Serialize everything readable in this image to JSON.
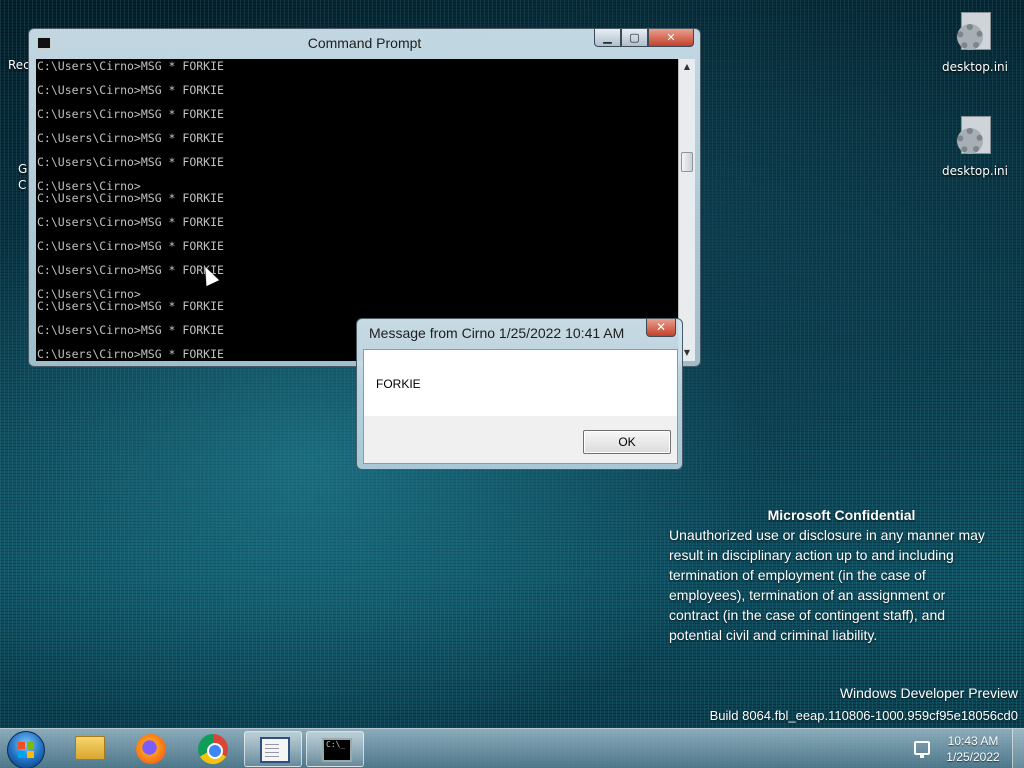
{
  "desktop": {
    "icons": [
      {
        "label": "desktop.ini"
      },
      {
        "label": "desktop.ini"
      }
    ],
    "edge_labels": {
      "top": "Rec",
      "mid1": "G",
      "mid2": "C"
    }
  },
  "cmd_window": {
    "title": "Command Prompt",
    "buttons": {
      "minimize": "▁",
      "maximize": "▢",
      "close": "✕"
    },
    "lines": [
      "C:\\Users\\Cirno>MSG * FORKIE",
      "C:\\Users\\Cirno>MSG * FORKIE",
      "C:\\Users\\Cirno>MSG * FORKIE",
      "C:\\Users\\Cirno>MSG * FORKIE",
      "C:\\Users\\Cirno>MSG * FORKIE",
      "C:\\Users\\Cirno>",
      "C:\\Users\\Cirno>MSG * FORKIE",
      "C:\\Users\\Cirno>MSG * FORKIE",
      "C:\\Users\\Cirno>MSG * FORKIE",
      "C:\\Users\\Cirno>MSG * FORKIE",
      "C:\\Users\\Cirno>",
      "C:\\Users\\Cirno>MSG * FORKIE",
      "C:\\Users\\Cirno>MSG * FORKIE",
      "C:\\Users\\Cirno>MSG * FORKIE"
    ]
  },
  "message_box": {
    "title": "Message from Cirno 1/25/2022 10:41 AM",
    "close": "✕",
    "text": "FORKIE",
    "ok_label": "OK"
  },
  "watermark": {
    "title": "Microsoft Confidential",
    "lines": [
      "Unauthorized use or disclosure in any manner may",
      "result in disciplinary action up to and including",
      "termination of employment (in the case of",
      "employees), termination of an assignment or",
      "contract (in the case of contingent staff), and",
      "potential civil and criminal liability."
    ],
    "build_line1": "Windows Developer Preview",
    "build_line2": "Build 8064.fbl_eeap.110806-1000.959cf95e18056cd0"
  },
  "taskbar": {
    "clock_time": "10:43 AM",
    "clock_date": "1/25/2022",
    "cmd_icon_text": "C:\\_"
  }
}
